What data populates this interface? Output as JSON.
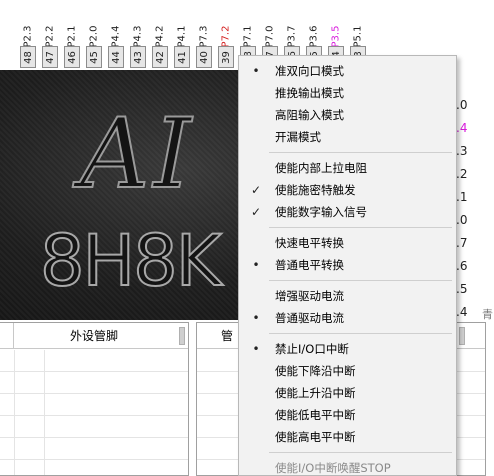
{
  "pins": [
    {
      "label": "P2.3",
      "num": "48",
      "color": "normal"
    },
    {
      "label": "P2.2",
      "num": "47",
      "color": "normal"
    },
    {
      "label": "P2.1",
      "num": "46",
      "color": "normal"
    },
    {
      "label": "P2.0",
      "num": "45",
      "color": "normal"
    },
    {
      "label": "P4.4",
      "num": "44",
      "color": "normal"
    },
    {
      "label": "P4.3",
      "num": "43",
      "color": "normal"
    },
    {
      "label": "P4.2",
      "num": "42",
      "color": "normal"
    },
    {
      "label": "P4.1",
      "num": "41",
      "color": "normal"
    },
    {
      "label": "P7.3",
      "num": "40",
      "color": "normal"
    },
    {
      "label": "P7.2",
      "num": "39",
      "color": "red"
    },
    {
      "label": "P7.1",
      "num": "38",
      "color": "normal"
    },
    {
      "label": "P7.0",
      "num": "37",
      "color": "normal"
    },
    {
      "label": "P3.7",
      "num": "36",
      "color": "normal"
    },
    {
      "label": "P3.6",
      "num": "35",
      "color": "normal"
    },
    {
      "label": "P3.5",
      "num": "34",
      "color": "magenta"
    },
    {
      "label": "P5.1",
      "num": "33",
      "color": "normal"
    }
  ],
  "chip": {
    "line1": "AI",
    "line2": "8H8K"
  },
  "right_values": [
    {
      "text": ".0",
      "color": "normal"
    },
    {
      "text": ".4",
      "color": "magenta"
    },
    {
      "text": ".3",
      "color": "normal"
    },
    {
      "text": ".2",
      "color": "normal"
    },
    {
      "text": ".1",
      "color": "normal"
    },
    {
      "text": ".0",
      "color": "normal"
    },
    {
      "text": ".7",
      "color": "normal"
    },
    {
      "text": ".6",
      "color": "normal"
    },
    {
      "text": ".5",
      "color": "normal"
    },
    {
      "text": ".4",
      "color": "normal"
    }
  ],
  "side_clip_text": "青",
  "left_table": {
    "header": "外设管脚"
  },
  "right_table": {
    "header": "管"
  },
  "menu": {
    "groups": [
      [
        {
          "label": "准双向口模式",
          "mark": "•",
          "disabled": false
        },
        {
          "label": "推挽输出模式",
          "mark": "",
          "disabled": false
        },
        {
          "label": "高阻输入模式",
          "mark": "",
          "disabled": false
        },
        {
          "label": "开漏模式",
          "mark": "",
          "disabled": false
        }
      ],
      [
        {
          "label": "使能内部上拉电阻",
          "mark": "",
          "disabled": false
        },
        {
          "label": "使能施密特触发",
          "mark": "✓",
          "disabled": false
        },
        {
          "label": "使能数字输入信号",
          "mark": "✓",
          "disabled": false
        }
      ],
      [
        {
          "label": "快速电平转换",
          "mark": "",
          "disabled": false
        },
        {
          "label": "普通电平转换",
          "mark": "•",
          "disabled": false
        }
      ],
      [
        {
          "label": "增强驱动电流",
          "mark": "",
          "disabled": false
        },
        {
          "label": "普通驱动电流",
          "mark": "•",
          "disabled": false
        }
      ],
      [
        {
          "label": "禁止I/O口中断",
          "mark": "•",
          "disabled": false
        },
        {
          "label": "使能下降沿中断",
          "mark": "",
          "disabled": false
        },
        {
          "label": "使能上升沿中断",
          "mark": "",
          "disabled": false
        },
        {
          "label": "使能低电平中断",
          "mark": "",
          "disabled": false
        },
        {
          "label": "使能高电平中断",
          "mark": "",
          "disabled": false
        }
      ],
      [
        {
          "label": "使能I/O中断唤醒STOP",
          "mark": "",
          "disabled": true
        }
      ]
    ]
  }
}
